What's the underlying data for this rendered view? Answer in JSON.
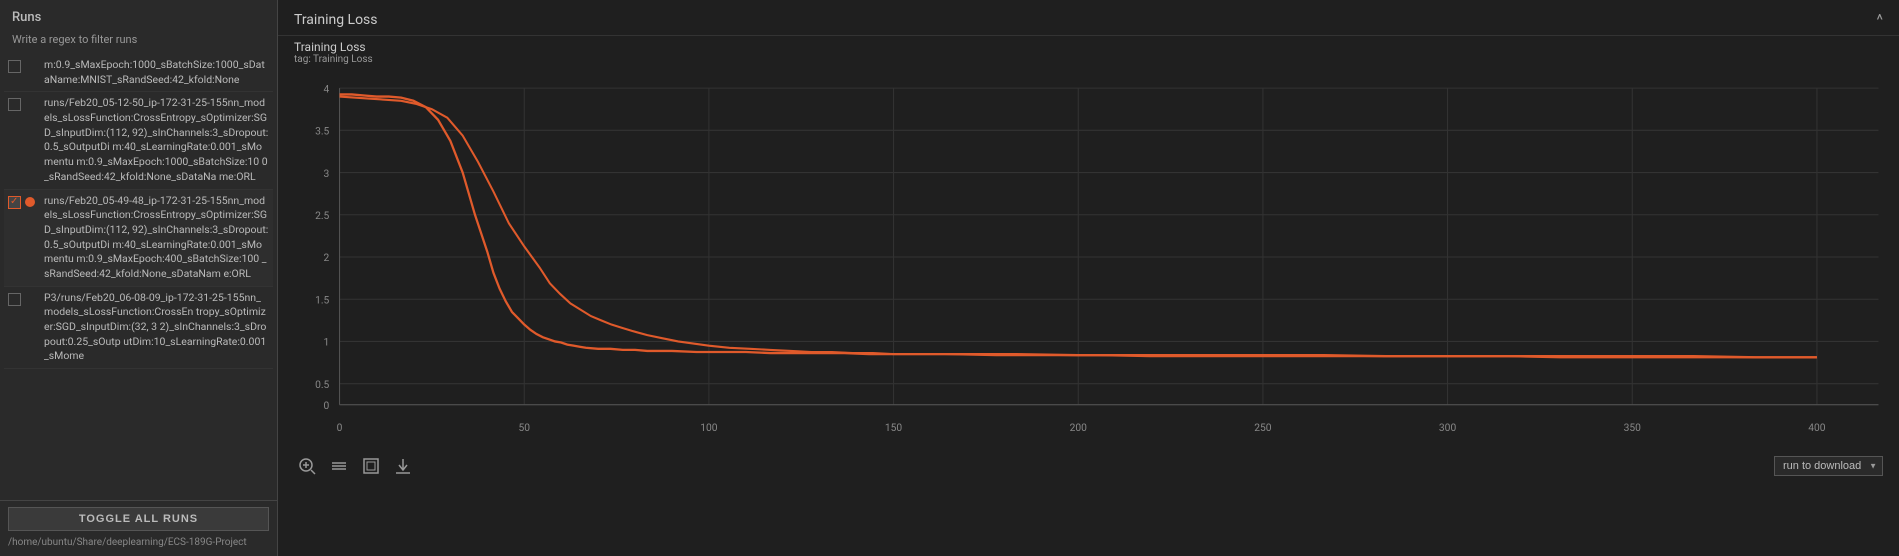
{
  "sidebar": {
    "runs_label": "Runs",
    "filter_placeholder": "Write a regex to filter runs",
    "runs": [
      {
        "id": "run1",
        "name": "m:0.9_sMaxEpoch:1000_sBatchSize:1000_sDataName:MNIST_sRandSeed:42_kfold:None",
        "checked": false,
        "color": null,
        "show_dot": false
      },
      {
        "id": "run2",
        "name": "runs/Feb20_05-12-50_ip-172-31-25-155nn_models_sLossFunction:CrossEntropy_sOptimizer:SGD_sInputDim:(112, 92)_sInChannels:3_sDropout:0.5_sOutputDim:40_sLearningRate:0.001_sMomentum:0.9_sMaxEpoch:1000_sBatchSize:100_sRandSeed:42_kfold:None_sDataName:ORL",
        "checked": false,
        "color": null,
        "show_dot": false
      },
      {
        "id": "run3",
        "name": "runs/Feb20_05-49-48_ip-172-31-25-155nn_models_sLossFunction:CrossEntropy_sOptimizer:SGD_sInputDim:(112, 92)_sInChannels:3_sDropout:0.5_sOutputDim:40_sLearningRate:0.001_sMomentum:0.9_sMaxEpoch:400_sBatchSize:100_sRandSeed:42_kfold:None_sDataName:ORL",
        "checked": true,
        "color": "#e05a2b",
        "show_dot": true
      },
      {
        "id": "run4",
        "name": "P3/runs/Feb20_06-08-09_ip-172-31-25-155nn_models_sLossFunction:CrossEntropy_sOptimizer:SGD_sInputDim:(32, 32)_sInChannels:3_sDropout:0.25_sOutputDim:10_sLearningRate:0.001_sMome",
        "checked": false,
        "color": null,
        "show_dot": false
      }
    ],
    "toggle_all_label": "TOGGLE ALL RUNS",
    "footer_path": "/home/ubuntu/Share/deeplearning/ECS-189G-Project"
  },
  "chart": {
    "title": "Training Loss",
    "info_title": "Training Loss",
    "info_tag": "tag: Training Loss",
    "collapse_icon": "^",
    "y_axis": {
      "max": 4.0,
      "values": [
        "4",
        "3.5",
        "3",
        "2.5",
        "2",
        "1.5",
        "1",
        "0.5",
        "0"
      ]
    },
    "x_axis": {
      "values": [
        "0",
        "50",
        "100",
        "150",
        "200",
        "250",
        "300",
        "350",
        "400"
      ]
    },
    "download_label": "run to download",
    "tools": [
      {
        "name": "zoom-icon",
        "icon": "+"
      },
      {
        "name": "pan-icon",
        "icon": "≡"
      },
      {
        "name": "fit-icon",
        "icon": "⊡"
      },
      {
        "name": "download-icon",
        "icon": "⬇"
      }
    ]
  }
}
